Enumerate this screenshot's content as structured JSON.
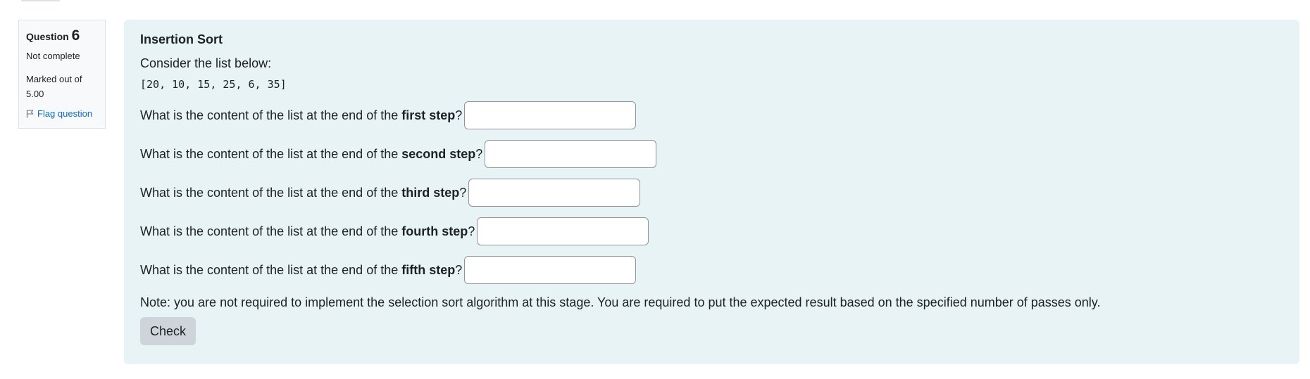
{
  "info": {
    "question_label": "Question",
    "question_number": "6",
    "state": "Not complete",
    "grade_line1": "Marked out of",
    "grade_line2": "5.00",
    "flag_label": "Flag question"
  },
  "question": {
    "title": "Insertion Sort",
    "intro": "Consider the list below:",
    "list_code": "[20, 10, 15, 25, 6, 35]",
    "prompt_prefix": "What is the content of the list at the end of the ",
    "prompt_suffix": "?",
    "steps": [
      {
        "label": "first step",
        "value": ""
      },
      {
        "label": "second step",
        "value": ""
      },
      {
        "label": "third step",
        "value": ""
      },
      {
        "label": "fourth step",
        "value": ""
      },
      {
        "label": "fifth step",
        "value": ""
      }
    ],
    "note": "Note: you are not required to implement the selection sort algorithm at this stage. You are required to put the expected result based on the specified number of passes only.",
    "check_label": "Check"
  },
  "colors": {
    "content_bg": "#e7f3f5",
    "link": "#0f6cbf",
    "button_bg": "#ced4da"
  },
  "icons": {
    "flag": "flag-icon"
  }
}
